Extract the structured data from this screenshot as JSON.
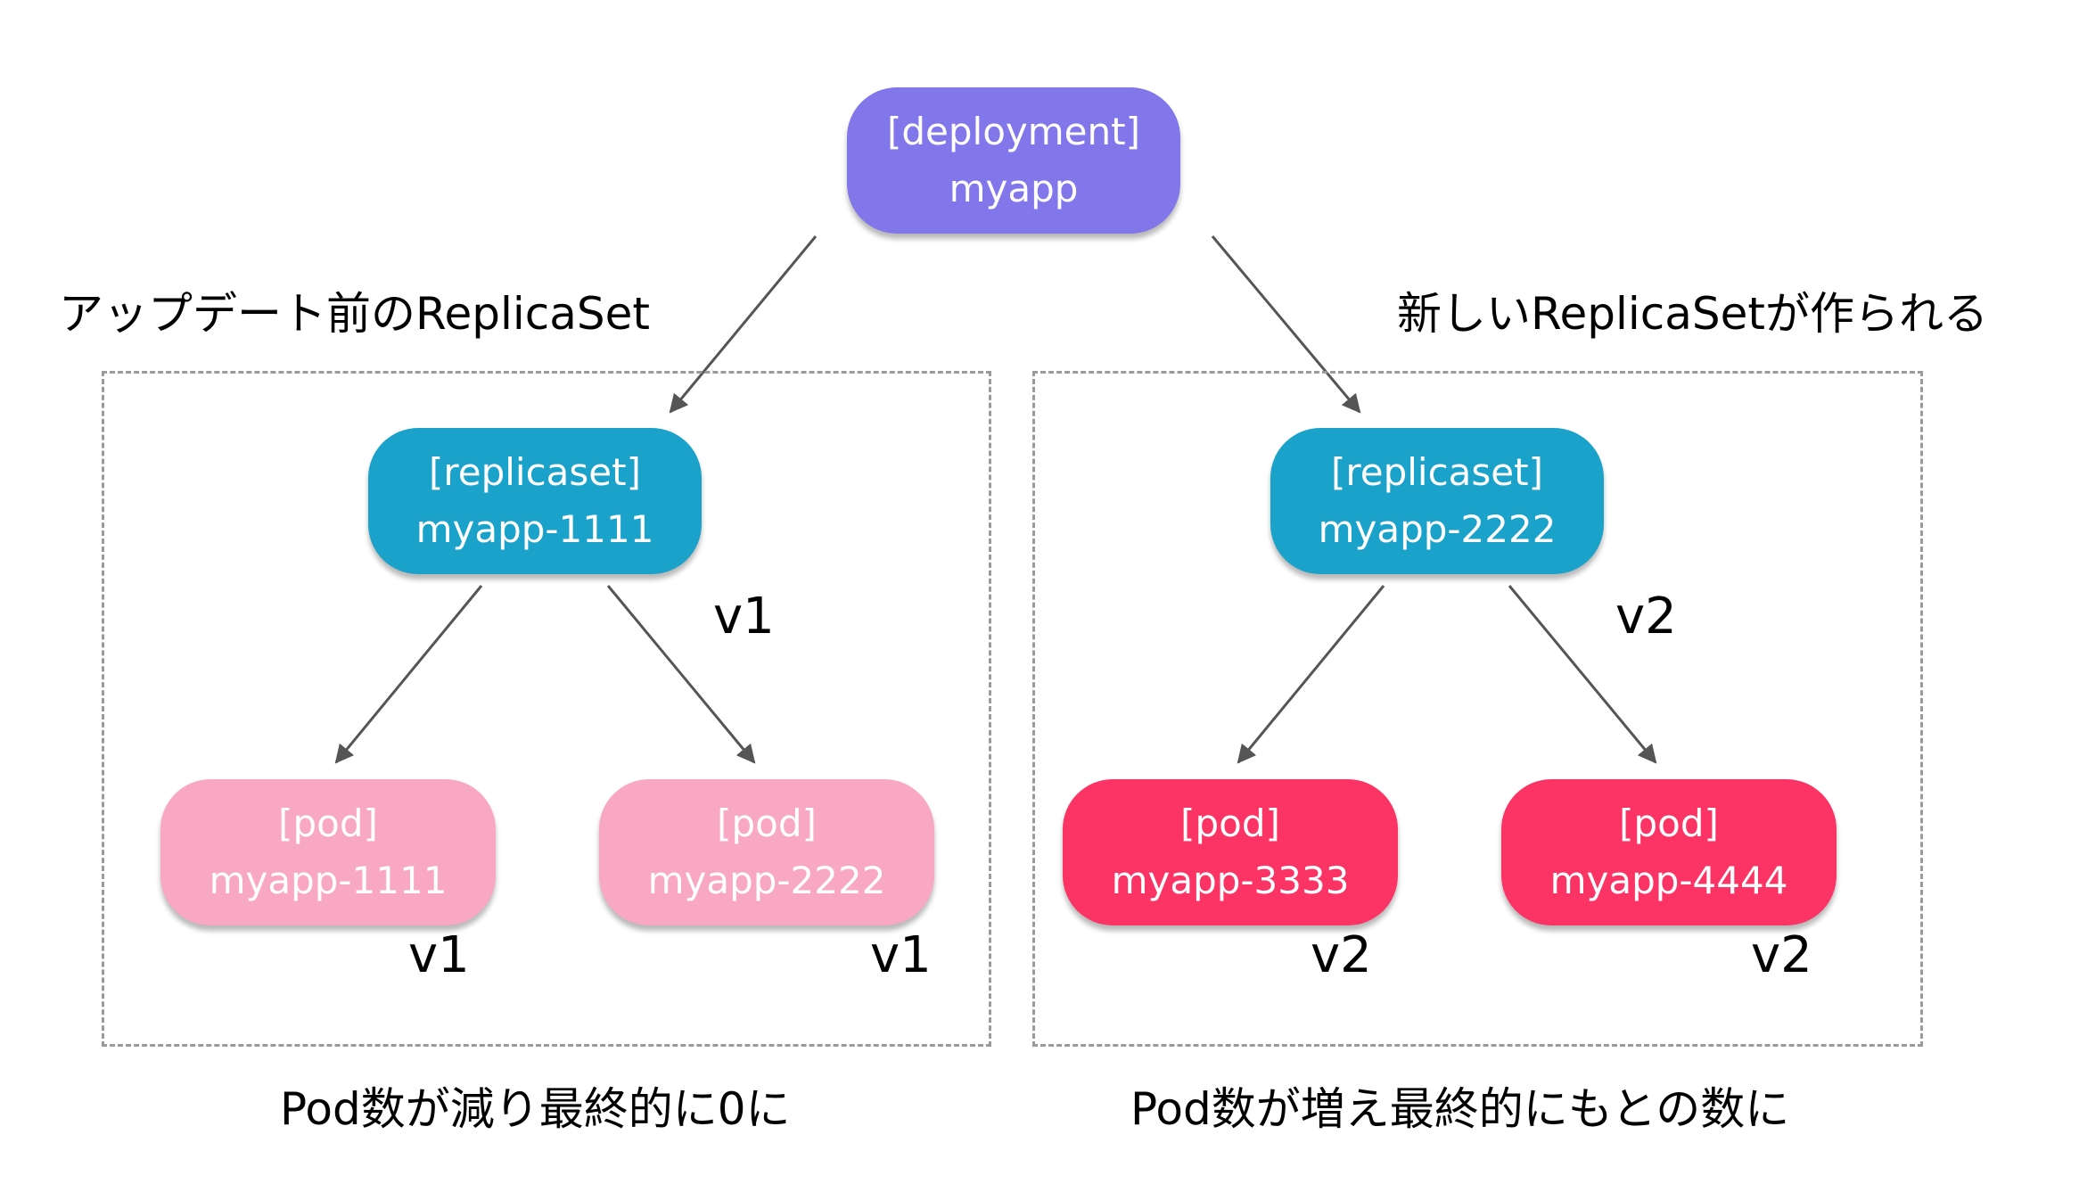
{
  "deployment": {
    "type": "[deployment]",
    "name": "myapp"
  },
  "old_replicaset": {
    "caption": "アップデート前のReplicaSet",
    "type": "[replicaset]",
    "name": "myapp-1111",
    "version": "v1",
    "color": "#1aa2cb",
    "pods": [
      {
        "type": "[pod]",
        "name": "myapp-1111",
        "version": "v1"
      },
      {
        "type": "[pod]",
        "name": "myapp-2222",
        "version": "v1"
      }
    ],
    "pod_color": "#f9a8c3",
    "footer": "Pod数が減り最終的に0に"
  },
  "new_replicaset": {
    "caption": "新しいReplicaSetが作られる",
    "type": "[replicaset]",
    "name": "myapp-2222",
    "version": "v2",
    "color": "#1aa2cb",
    "pods": [
      {
        "type": "[pod]",
        "name": "myapp-3333",
        "version": "v2"
      },
      {
        "type": "[pod]",
        "name": "myapp-4444",
        "version": "v2"
      }
    ],
    "pod_color": "#fc3465",
    "footer": "Pod数が増え最終的にもとの数に"
  },
  "deployment_color": "#8176ea",
  "edge_color": "#555555"
}
